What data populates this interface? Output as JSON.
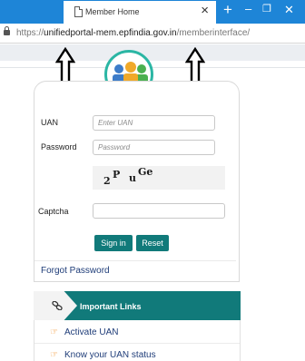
{
  "browser": {
    "tab_title": "Member Home",
    "url_protocol": "https://",
    "url_host": "unifiedportal-mem.epfindia.gov.in",
    "url_path": "/memberinterface/"
  },
  "login": {
    "uan_label": "UAN",
    "uan_placeholder": "Enter UAN",
    "password_label": "Password",
    "password_placeholder": "Password",
    "captcha_text": [
      "2",
      "P",
      "u",
      "Ge"
    ],
    "captcha_label": "Captcha",
    "captcha_value": "",
    "signin_label": "Sign in",
    "reset_label": "Reset",
    "forgot_label": "Forgot Password"
  },
  "important_links": {
    "title": "Important Links",
    "items": [
      {
        "label": "Activate UAN"
      },
      {
        "label": "Know your UAN status"
      }
    ]
  },
  "colors": {
    "tab_bar": "#1e85d7",
    "teal": "#117a7a",
    "link": "#1e3c78",
    "hand": "#f08a1c"
  }
}
